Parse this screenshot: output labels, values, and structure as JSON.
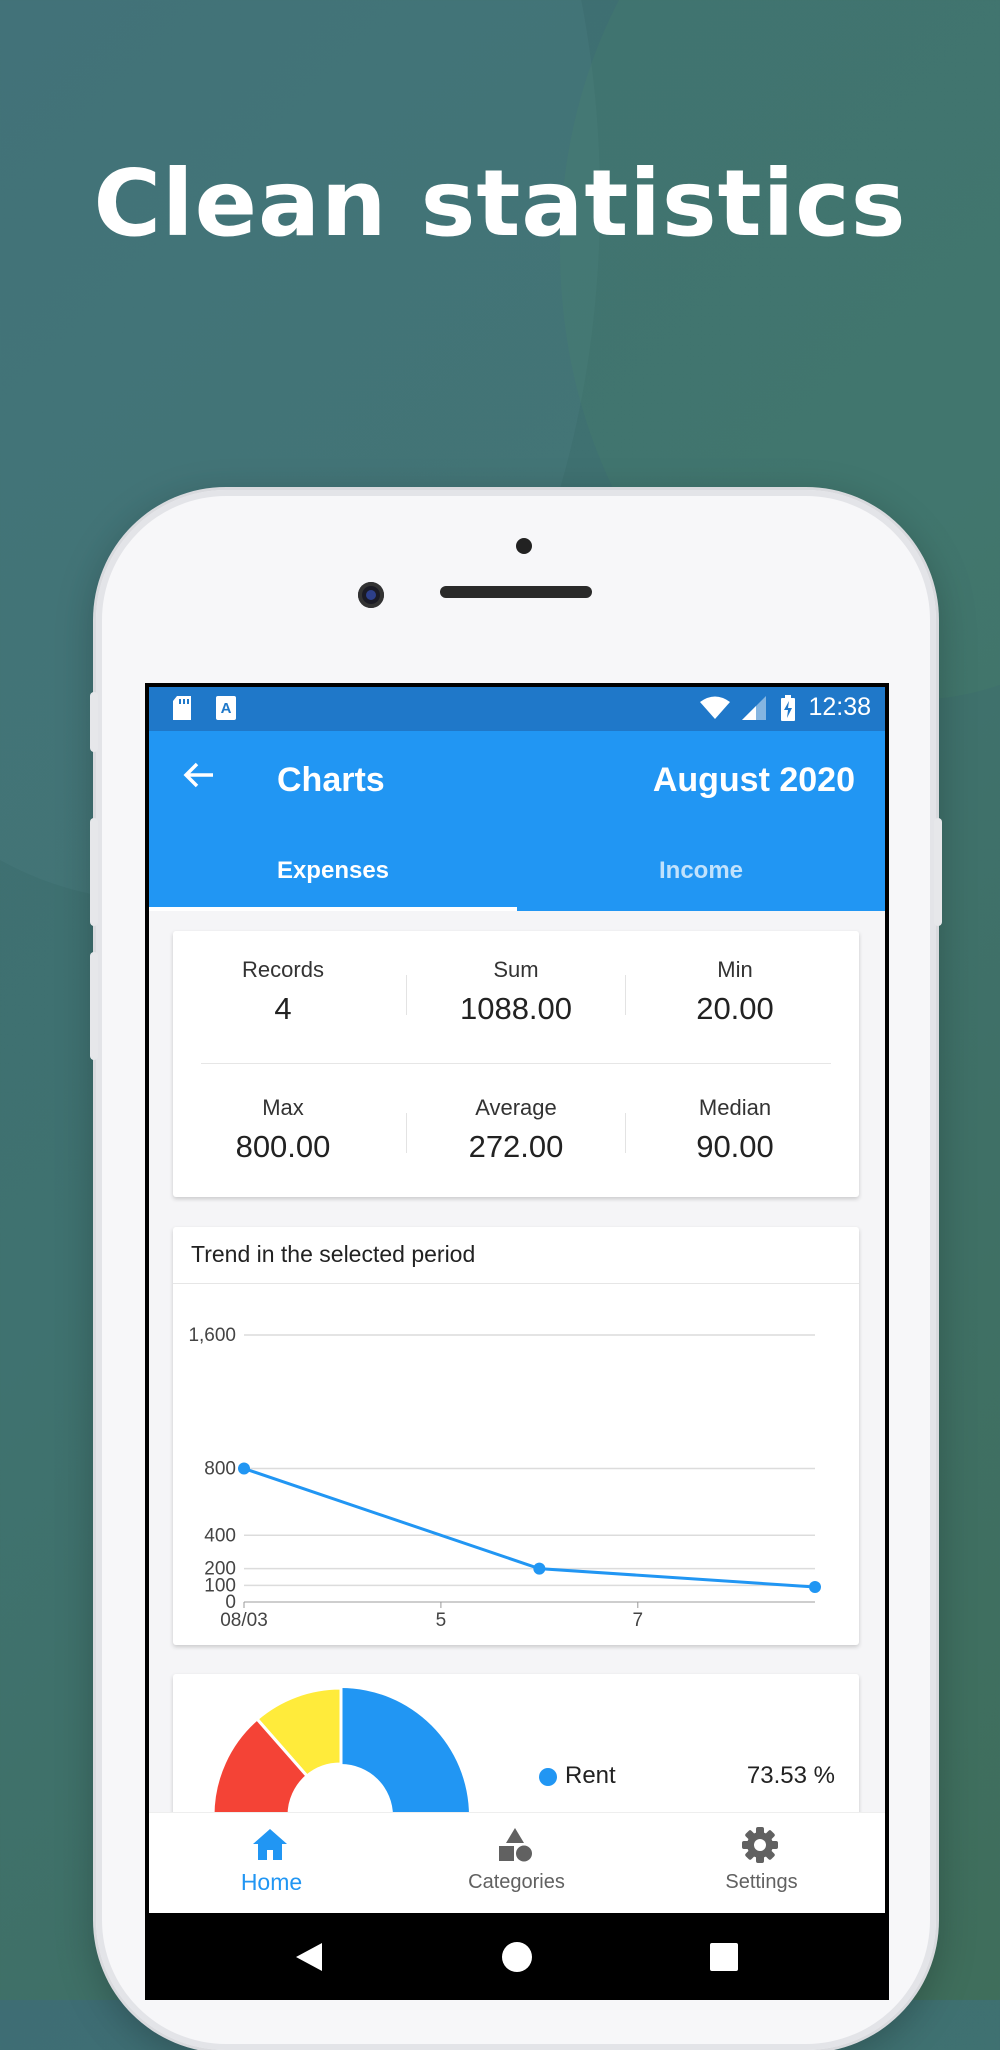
{
  "headline": "Clean statistics",
  "colors": {
    "primary": "#2196f3",
    "status_bar": "#1f78c9",
    "rent": "#2196f3",
    "red": "#f44336",
    "yellow": "#ffeb3b"
  },
  "status_bar": {
    "time": "12:38",
    "icons": [
      "sd-card-icon",
      "font-a-icon",
      "wifi-icon",
      "signal-icon",
      "battery-charging-icon"
    ]
  },
  "app_bar": {
    "title": "Charts",
    "period": "August 2020"
  },
  "tabs": [
    {
      "label": "Expenses",
      "selected": true
    },
    {
      "label": "Income",
      "selected": false
    }
  ],
  "stats": [
    {
      "label": "Records",
      "value": "4"
    },
    {
      "label": "Sum",
      "value": "1088.00"
    },
    {
      "label": "Min",
      "value": "20.00"
    },
    {
      "label": "Max",
      "value": "800.00"
    },
    {
      "label": "Average",
      "value": "272.00"
    },
    {
      "label": "Median",
      "value": "90.00"
    }
  ],
  "trend": {
    "title": "Trend in the selected period"
  },
  "chart_data": {
    "type": "line",
    "title": "Trend in the selected period",
    "x": [
      "08/03",
      "08/06",
      "08/08"
    ],
    "x_tick_labels": [
      "08/03",
      "5",
      "7"
    ],
    "values": [
      800,
      200,
      90
    ],
    "y_ticks": [
      "1,600",
      "800",
      "400",
      "200",
      "100",
      "0"
    ],
    "ylim": [
      0,
      1600
    ],
    "grid": true
  },
  "pie": {
    "legend": [
      {
        "name": "Rent",
        "percent": "73.53 %"
      }
    ]
  },
  "bottom_nav": [
    {
      "label": "Home",
      "icon": "home-icon",
      "active": true
    },
    {
      "label": "Categories",
      "icon": "categories-icon",
      "active": false
    },
    {
      "label": "Settings",
      "icon": "gear-icon",
      "active": false
    }
  ]
}
